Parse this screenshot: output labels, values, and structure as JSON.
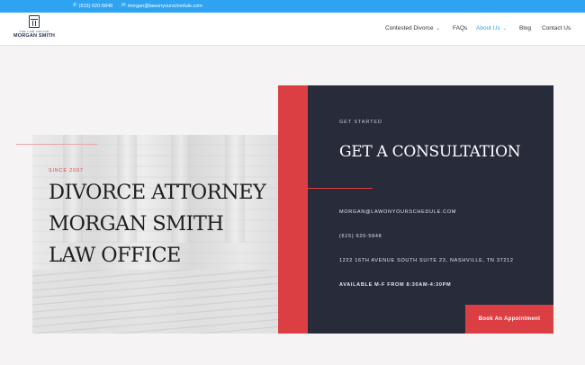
{
  "topbar": {
    "phone_icon": "phone-icon",
    "phone": "(615) 620-5848",
    "email_icon": "envelope-icon",
    "email": "morgan@lawonyourschedule.com"
  },
  "logo": {
    "top_text": "THE LAW OFFICE",
    "name": "MORGAN SMITH"
  },
  "nav": {
    "items": [
      {
        "label": "Contested Divorce",
        "has_dropdown": true,
        "active": false
      },
      {
        "label": "FAQs",
        "has_dropdown": false,
        "active": false
      },
      {
        "label": "About Us",
        "has_dropdown": true,
        "active": true
      },
      {
        "label": "Blog",
        "has_dropdown": false,
        "active": false
      },
      {
        "label": "Contact Us",
        "has_dropdown": false,
        "active": false
      }
    ],
    "chevron_icon": "chevron-down-icon"
  },
  "hero": {
    "since": "SINCE 2007",
    "title_lines": [
      "DIVORCE ATTORNEY",
      "MORGAN SMITH",
      "LAW OFFICE"
    ]
  },
  "consultation": {
    "eyebrow": "GET STARTED",
    "title": "GET A CONSULTATION",
    "email": "MORGAN@LAWONYOURSCHEDULE.COM",
    "phone": "(615) 620-5848",
    "address": "1222 16TH AVENUE SOUTH SUITE 23, NASHVILLE, TN 37212",
    "hours": "AVAILABLE M-F FROM 8:30AM-4:30PM",
    "button": "Book An Appointment"
  },
  "colors": {
    "topbar": "#2ea3f2",
    "accent_red": "#dc3f43",
    "panel_dark": "#272b3a",
    "nav_active": "#2ea3f2"
  }
}
